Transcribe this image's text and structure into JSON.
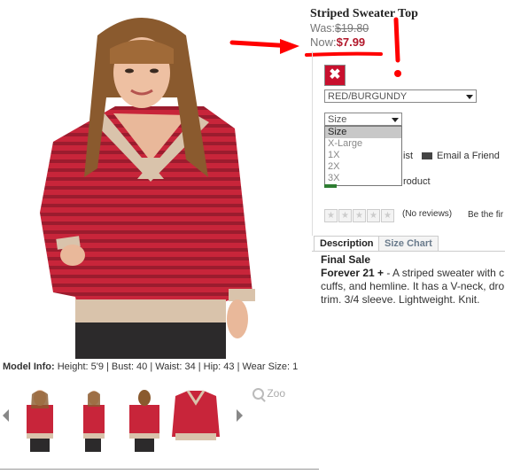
{
  "product": {
    "title": "Striped Sweater Top",
    "was_label": "Was:",
    "was_price": "$19.80",
    "now_label": "Now:",
    "now_price": "$7.99"
  },
  "options": {
    "swatch_icon": "close-x-icon",
    "swatch_mark": "✖",
    "color_value": "RED/BURGUNDY",
    "size_value": "Size",
    "size_options": [
      "Size",
      "X-Large",
      "1X",
      "2X",
      "3X"
    ]
  },
  "actions": {
    "wishlist_partial": "ist",
    "email_friend": "Email a Friend",
    "add_partial": "roduct"
  },
  "reviews": {
    "no_reviews": "(No reviews)",
    "be_first": "Be the fir"
  },
  "tabs": {
    "description": "Description",
    "size_chart": "Size Chart"
  },
  "description": {
    "heading": "Final Sale",
    "brand": "Forever 21 +",
    "text": " - A striped sweater with c cuffs, and hemline. It has a V-neck, dro trim. 3/4 sleeve. Lightweight. Knit."
  },
  "model_info": {
    "label": "Model Info:",
    "text": "Height: 5'9 | Bust: 40 | Waist: 34 | Hip: 43 | Wear Size: 1"
  },
  "gallery": {
    "zoom_label": "Zoo"
  },
  "colors": {
    "price_red": "#b2182b",
    "annotation_red": "#ff0000",
    "sweater_red": "#c8253a",
    "trim_beige": "#d9c3ab"
  }
}
